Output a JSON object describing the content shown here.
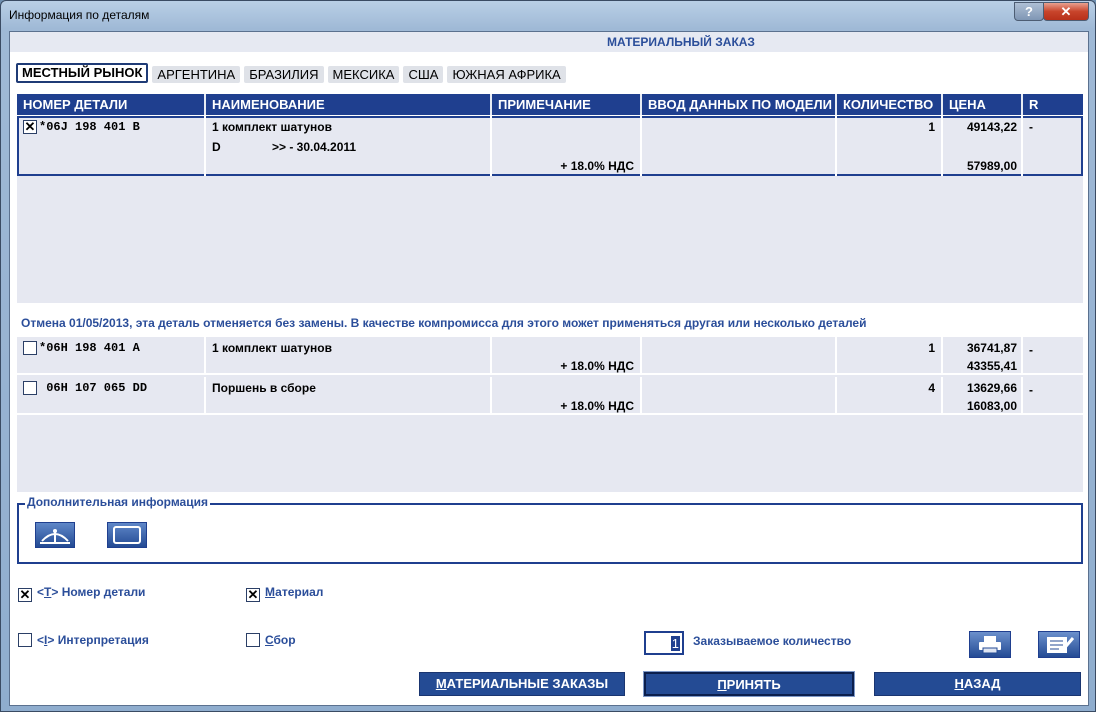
{
  "window": {
    "title": "Информация по деталям",
    "help_glyph": "?",
    "close_glyph": "✕"
  },
  "banner": {
    "title": "МАТЕРИАЛЬНЫЙ ЗАКАЗ"
  },
  "tabs": [
    {
      "label": "МЕСТНЫЙ РЫНОК",
      "active": true
    },
    {
      "label": "АРГЕНТИНА",
      "active": false
    },
    {
      "label": "БРАЗИЛИЯ",
      "active": false
    },
    {
      "label": "МЕКСИКА",
      "active": false
    },
    {
      "label": "США",
      "active": false
    },
    {
      "label": "ЮЖНАЯ АФРИКА",
      "active": false
    }
  ],
  "table": {
    "columns": [
      "НОМЕР ДЕТАЛИ",
      "НАИМЕНОВАНИЕ",
      "ПРИМЕЧАНИЕ",
      "ВВОД ДАННЫХ ПО МОДЕЛИ",
      "КОЛИЧЕСТВО",
      "ЦЕНА",
      "R"
    ],
    "main_rows": [
      {
        "checked": true,
        "part_no": "*06J 198 401 B",
        "name": "1 комплект шатунов",
        "name2": "D",
        "date": ">> - 30.04.2011",
        "note": "+ 18.0% НДС",
        "qty": "1",
        "price": "49143,22",
        "price_vat": "57989,00",
        "r": "-"
      }
    ],
    "notice": "Отмена 01/05/2013, эта деталь отменяется без замены. В качестве компромисса для этого может применяться другая или несколько деталей",
    "alt_rows": [
      {
        "checked": false,
        "part_no": "*06H 198 401 A",
        "name": "1 комплект шатунов",
        "note": "+ 18.0% НДС",
        "qty": "1",
        "price": "36741,87",
        "price_vat": "43355,41",
        "r": "-"
      },
      {
        "checked": false,
        "part_no": " 06H 107 065 DD",
        "name": "Поршень в сборе",
        "note": "+ 18.0% НДС",
        "qty": "4",
        "price": "13629,66",
        "price_vat": "16083,00",
        "r": "-"
      }
    ]
  },
  "extra_info": {
    "title": "Дополнительная информация",
    "icons": [
      "scale-icon",
      "frame-icon"
    ]
  },
  "options": {
    "part_number": {
      "label_prefix": "<",
      "hotkey": "T",
      "label_suffix": "> Номер детали",
      "checked": true
    },
    "material": {
      "hotkey": "М",
      "label_rest": "атериал",
      "checked": true
    },
    "interpretation": {
      "label_prefix": "<",
      "hotkey": "I",
      "label_suffix": "> Интерпретация",
      "checked": false
    },
    "assembly": {
      "hotkey": "С",
      "label_rest": "бор",
      "checked": false
    }
  },
  "order_qty": {
    "value": "1",
    "label": "Заказываемое количество"
  },
  "tools": [
    "printer-icon",
    "edit-note-icon"
  ],
  "actions": {
    "orders": {
      "hotkey": "М",
      "rest": "АТЕРИАЛЬНЫЕ ЗАКАЗЫ"
    },
    "accept": {
      "hotkey": "П",
      "rest": "РИНЯТЬ"
    },
    "back": {
      "hotkey": "Н",
      "rest": "АЗАД"
    }
  },
  "colors": {
    "header_blue": "#1f3f8f",
    "label_blue": "#2b4e9a",
    "pane_gray": "#e6e8f1"
  }
}
